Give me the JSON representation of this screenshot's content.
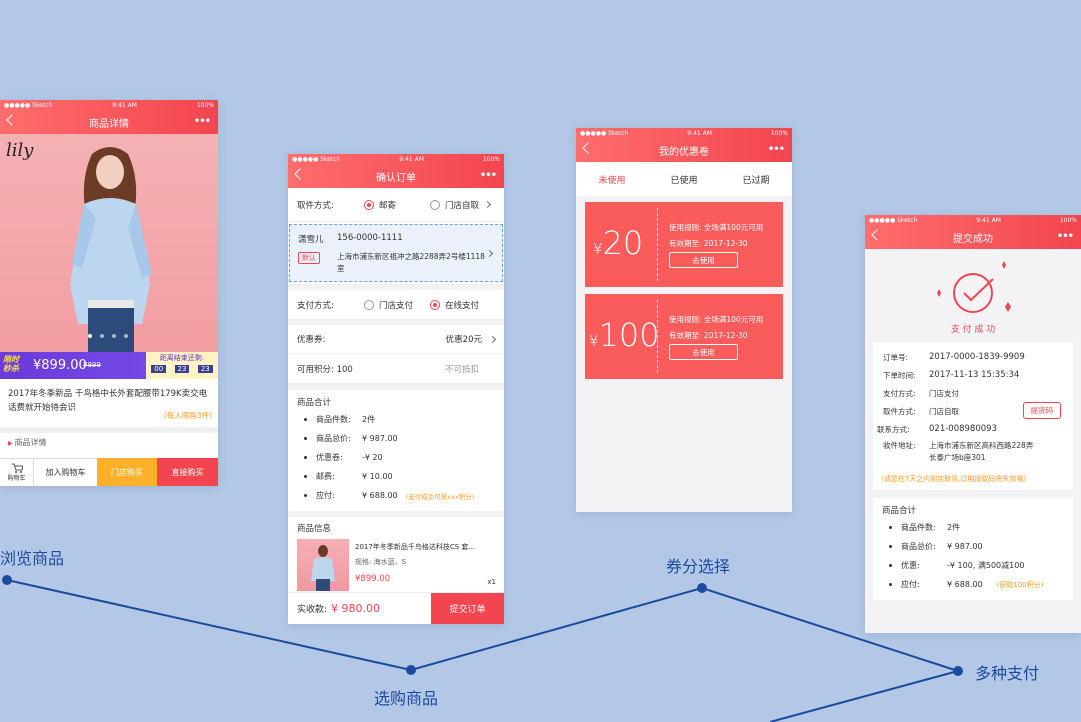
{
  "colors": {
    "primary": "#f2454f",
    "line": "#1c4a9c",
    "background": "#b3c8e6",
    "accent_orange": "#ff9a1f"
  },
  "status": {
    "carrier": "●●●●● Sketch",
    "time": "9:41 AM",
    "battery": "100%"
  },
  "flow": {
    "step1": "浏览商品",
    "step2": "选购商品",
    "step3": "券分选择",
    "step4": "多种支付"
  },
  "s1": {
    "title": "商品详情",
    "brand": "lily",
    "promo_badge_line1": "限时",
    "promo_badge_line2": "秒杀",
    "price": "¥899.00",
    "old_price": "¥899",
    "countdown_label": "距离结束还剩:",
    "countdown": [
      "00",
      "23",
      "23"
    ],
    "desc": "2017年冬季新品 千鸟格中长外套配腰带179K卖交电话费就开始待会识",
    "limit": "(每人限购3件)",
    "detail_link": "商品详情",
    "cart": "购物车",
    "add_cart": "加入购物车",
    "store_buy": "门店购买",
    "direct_buy": "直接购买"
  },
  "s2": {
    "title": "确认订单",
    "pickup_label": "取件方式:",
    "mail": "邮寄",
    "store_pickup": "门店自取",
    "recipient": "潇雪儿",
    "phone": "156-0000-1111",
    "default_tag": "默认",
    "address": "上海市浦东新区祖冲之路2288弄2号楼1118室",
    "pay_label": "支付方式:",
    "store_pay": "门店支付",
    "online_pay": "在线支付",
    "coupon_label": "优惠券:",
    "coupon_value": "优惠20元",
    "points_label": "可用积分: 100",
    "points_note": "不可抵扣",
    "summary_title": "商品合计",
    "items": [
      {
        "k": "商品件数:",
        "v": "2件"
      },
      {
        "k": "商品总价:",
        "v": "¥ 987.00"
      },
      {
        "k": "优惠卷:",
        "v": "-¥ 20"
      },
      {
        "k": "邮费:",
        "v": "¥ 10.00"
      },
      {
        "k": "应付:",
        "v": "¥ 688.00"
      }
    ],
    "success_note": "(支付成功可获xxx积分)",
    "info_title": "商品信息",
    "product_name": "2017年冬季新品千鸟格达科技CS 套...",
    "product_spec": "规格: 海水蓝、S",
    "product_price": "¥899.00",
    "qty": "x1",
    "actual_label": "实收款:",
    "actual_value": "¥ 980.00",
    "submit": "提交订单"
  },
  "s3": {
    "title": "我的优惠卷",
    "tabs": [
      "未使用",
      "已使用",
      "已过期"
    ],
    "coupons": [
      {
        "amount": "20",
        "rule": "使用规则: 全场满100元可用",
        "expire": "有效期至: 2017-12-30",
        "use": "去使用"
      },
      {
        "amount": "100",
        "rule": "使用规则: 全场满100元可用",
        "expire": "有效期至: 2017-12-30",
        "use": "去使用"
      }
    ]
  },
  "s4": {
    "title": "提交成功",
    "success": "支 付 成 功",
    "rows": [
      {
        "k": "订单号:",
        "v": "2017-0000-1839-9909"
      },
      {
        "k": "下单时间:",
        "v": "2017-11-13 15:35:34"
      },
      {
        "k": "支付方式:",
        "v": "门店支付"
      },
      {
        "k": "取件方式:",
        "v": "门店自取"
      },
      {
        "k": "联系方式:",
        "v": "021-008980093"
      },
      {
        "k": "收件地址:",
        "v": "上海市浦东新区高科西路228弄长泰广场b座301"
      }
    ],
    "pickup_code": "提货码",
    "note": "(请您在7天之内到店取货,过期提取码将失效哦)",
    "summary_title": "商品合计",
    "items": [
      {
        "k": "商品件数:",
        "v": "2件"
      },
      {
        "k": "商品总价:",
        "v": "¥ 987.00"
      },
      {
        "k": "优惠:",
        "v": "-¥ 100, 满500减100"
      },
      {
        "k": "应付:",
        "v": "¥ 688.00"
      }
    ],
    "bonus": "(获取100积分)"
  }
}
